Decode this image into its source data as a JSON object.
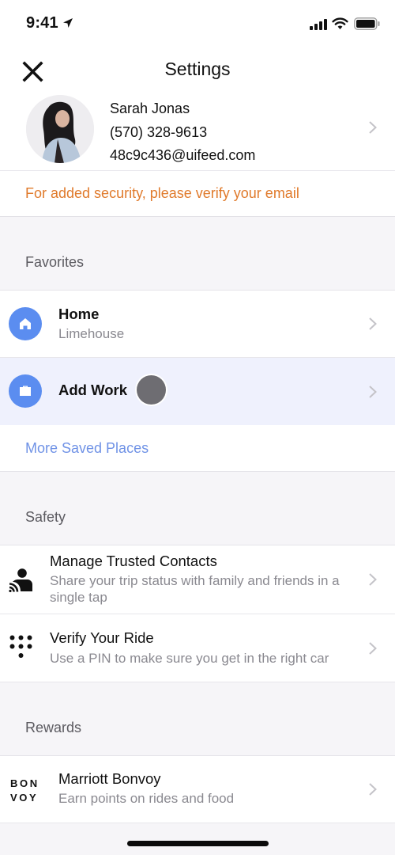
{
  "status_bar": {
    "time": "9:41",
    "icons": [
      "location-arrow-icon",
      "cellular-signal-icon",
      "wifi-icon",
      "battery-icon"
    ]
  },
  "nav": {
    "title": "Settings",
    "close_icon": "close-icon"
  },
  "profile": {
    "name": "Sarah Jonas",
    "phone": "(570) 328-9613",
    "email": "48c9c436@uifeed.com"
  },
  "verify_notice": {
    "text": "For added security, please verify your email",
    "color": "#e07a2b"
  },
  "favorites": {
    "header": "Favorites",
    "items": [
      {
        "title": "Home",
        "subtitle": "Limehouse",
        "icon": "home-icon"
      },
      {
        "title": "Add Work",
        "icon": "briefcase-icon",
        "highlighted": true
      }
    ],
    "more_link": "More Saved Places",
    "accent": "#5b8df0"
  },
  "safety": {
    "header": "Safety",
    "items": [
      {
        "title": "Manage Trusted Contacts",
        "subtitle": "Share your trip status with family and friends in a single tap",
        "icon": "trusted-contacts-icon"
      },
      {
        "title": "Verify Your Ride",
        "subtitle": "Use a PIN to make sure you get in the right car",
        "icon": "pin-keypad-icon"
      }
    ]
  },
  "rewards": {
    "header": "Rewards",
    "items": [
      {
        "title": "Marriott Bonvoy",
        "subtitle": "Earn points on rides and food",
        "logo_line1": "BON",
        "logo_line2": "VOY"
      }
    ]
  }
}
